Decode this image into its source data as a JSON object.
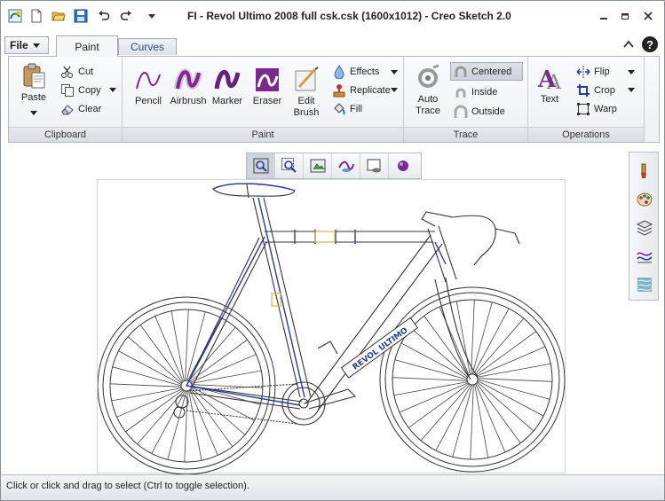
{
  "window": {
    "title": "FI - Revol Ultimo 2008 full csk.csk (1600x1012) - Creo Sketch 2.0"
  },
  "quick_access": [
    "app-icon",
    "new-icon",
    "open-icon",
    "save-icon",
    "undo-icon",
    "redo-icon",
    "customize-dropdown-icon"
  ],
  "menu": {
    "file_label": "File",
    "tabs": [
      {
        "label": "Paint",
        "active": true
      },
      {
        "label": "Curves",
        "active": false
      }
    ]
  },
  "ribbon": {
    "clipboard": {
      "label": "Clipboard",
      "paste": "Paste",
      "cut": "Cut",
      "copy": "Copy",
      "clear": "Clear"
    },
    "paint": {
      "label": "Paint",
      "pencil": "Pencil",
      "airbrush": "Airbrush",
      "marker": "Marker",
      "eraser": "Eraser",
      "edit_brush_1": "Edit",
      "edit_brush_2": "Brush",
      "effects": "Effects",
      "replicate": "Replicate",
      "fill": "Fill"
    },
    "trace": {
      "label": "Trace",
      "auto_trace_1": "Auto",
      "auto_trace_2": "Trace",
      "centered": "Centered",
      "inside": "Inside",
      "outside": "Outside"
    },
    "operations": {
      "label": "Operations",
      "text": "Text",
      "flip": "Flip",
      "crop": "Crop",
      "warp": "Warp"
    }
  },
  "colors": {
    "accent_purple": "#7a2a8c",
    "frame_blue": "#2a3b9a",
    "paper_border": "#d6d6d6",
    "ribbon_bg": "#eef1f5"
  },
  "frame_decal": "REVOL ULTIMO",
  "status": {
    "text": "Click or click and drag to select (Ctrl to toggle selection)."
  }
}
